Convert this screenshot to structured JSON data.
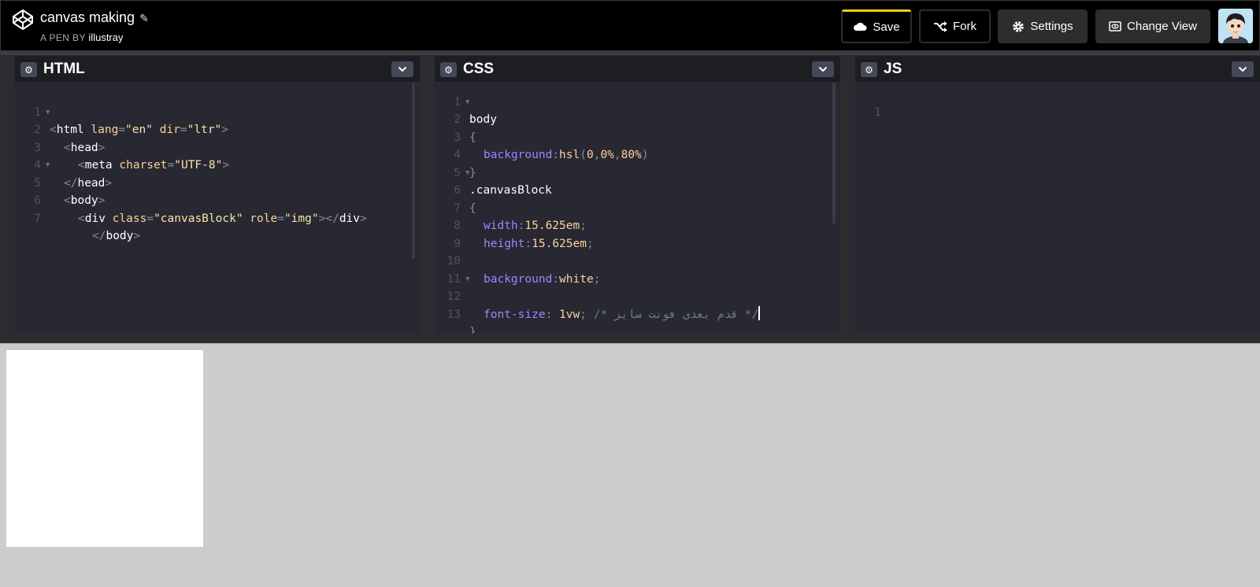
{
  "header": {
    "pen_title": "canvas making",
    "byline_prefix": "A PEN BY",
    "author": "illustray",
    "buttons": {
      "save": "Save",
      "fork": "Fork",
      "settings": "Settings",
      "change_view": "Change View"
    },
    "accent_color": "#e6d11d"
  },
  "editors": {
    "html": {
      "title": "HTML",
      "lines": [
        "1",
        "2",
        "3",
        "4",
        "5",
        "6",
        "7"
      ]
    },
    "css": {
      "title": "CSS",
      "lines": [
        "1",
        "2",
        "3",
        "4",
        "5",
        "6",
        "7",
        "8",
        "9",
        "10",
        "11",
        "12",
        "13"
      ],
      "comment_text": "/* قدم بعدی فونت سایز */"
    },
    "js": {
      "title": "JS",
      "lines": [
        "1"
      ]
    }
  },
  "code_tokens": {
    "html_l1": [
      "<",
      "html",
      "lang",
      "=",
      "\"en\"",
      "dir",
      "=",
      "\"ltr\"",
      ">"
    ],
    "html_l2": [
      "<",
      "head",
      ">"
    ],
    "html_l3": [
      "<",
      "meta",
      "charset",
      "=",
      "\"UTF-8\"",
      ">"
    ],
    "html_l4": [
      "</",
      "head",
      ">"
    ],
    "html_l5": [
      "<",
      "body",
      ">"
    ],
    "html_l6": [
      "<",
      "div",
      "class",
      "=",
      "\"canvasBlock\"",
      "role",
      "=",
      "\"img\"",
      "></",
      "div",
      ">"
    ],
    "html_l7": [
      "</",
      "body",
      ">"
    ],
    "css_l1": "body",
    "css_l2": "{",
    "css_l3": [
      "background",
      ":",
      "hsl",
      "(",
      "0",
      ",",
      "0%",
      ",",
      "80%",
      ")"
    ],
    "css_l4": "}",
    "css_l5": ".canvasBlock",
    "css_l6": "{",
    "css_l7": [
      "width",
      ":",
      "15.625em",
      ";"
    ],
    "css_l8": [
      "height",
      ":",
      "15.625em",
      ";"
    ],
    "css_l10": [
      "background",
      ":",
      "white",
      ";"
    ],
    "css_l12": [
      "font-size",
      ": ",
      "1vw",
      "; "
    ],
    "css_l13": "}"
  },
  "preview": {
    "background": "#cccccc",
    "block_color": "#ffffff"
  }
}
